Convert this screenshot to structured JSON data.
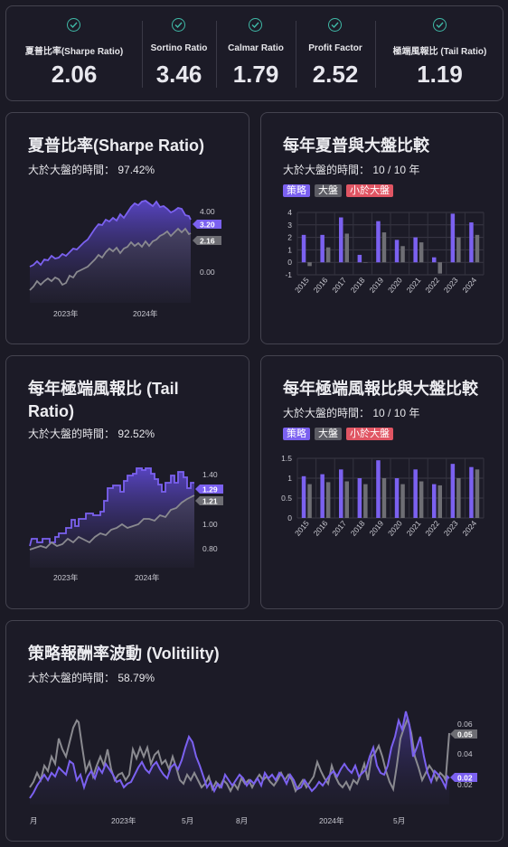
{
  "metrics": [
    {
      "label": "夏普比率(Sharpe Ratio)",
      "value": "2.06"
    },
    {
      "label": "Sortino Ratio",
      "value": "3.46"
    },
    {
      "label": "Calmar Ratio",
      "value": "1.79"
    },
    {
      "label": "Profit Factor",
      "value": "2.52"
    },
    {
      "label": "極端風報比 (Tail Ratio)",
      "value": "1.19"
    }
  ],
  "sharpe_card": {
    "title": "夏普比率(Sharpe Ratio)",
    "subtitle_label": "大於大盤的時間：",
    "subtitle_value": "97.42%",
    "yticks": [
      "4.00",
      "0.00"
    ],
    "strategy_last": "3.20",
    "market_last": "2.16",
    "xticks": [
      "2023年",
      "2024年"
    ]
  },
  "sharpe_yearly_card": {
    "title": "每年夏普與大盤比較",
    "subtitle_label": "大於大盤的時間：",
    "subtitle_value": "10 / 10 年"
  },
  "tail_card": {
    "title_line1": "每年極端風報比 (Tail",
    "title_line2": "Ratio)",
    "subtitle_label": "大於大盤的時間：",
    "subtitle_value": "92.52%",
    "yticks": [
      "1.40",
      "1.00",
      "0.80"
    ],
    "strategy_last": "1.29",
    "market_last": "1.21",
    "xticks": [
      "2023年",
      "2024年"
    ]
  },
  "tail_yearly_card": {
    "title": "每年極端風報比與大盤比較",
    "subtitle_label": "大於大盤的時間：",
    "subtitle_value": "10 / 10 年"
  },
  "vol_card": {
    "title": "策略報酬率波動 (Volitility)",
    "subtitle_label": "大於大盤的時間：",
    "subtitle_value": "58.79%",
    "yticks": [
      "0.06",
      "0.04",
      "0.02"
    ],
    "strategy_last": "0.02",
    "market_last": "0.05",
    "xticks": [
      "月",
      "2023年",
      "5月",
      "8月",
      "2024年",
      "5月"
    ]
  },
  "legend": {
    "strategy": "策略",
    "market": "大盤",
    "below": "小於大盤"
  },
  "colors": {
    "strategy": "#7b61f0",
    "market": "#6e6e74",
    "below": "#e05563",
    "check": "#3fb8a6"
  },
  "chart_data": [
    {
      "type": "bar",
      "title": "每年夏普與大盤比較",
      "categories": [
        "2015",
        "2016",
        "2017",
        "2018",
        "2019",
        "2020",
        "2021",
        "2022",
        "2023",
        "2024"
      ],
      "series": [
        {
          "name": "策略",
          "values": [
            2.2,
            2.2,
            3.6,
            0.6,
            3.3,
            1.8,
            2.0,
            0.4,
            3.9,
            3.2
          ]
        },
        {
          "name": "大盤",
          "values": [
            -0.3,
            1.2,
            2.3,
            0.0,
            2.4,
            1.3,
            1.6,
            -0.9,
            2.0,
            2.2
          ]
        }
      ],
      "yticks": [
        "4",
        "3",
        "2",
        "1",
        "0",
        "-1"
      ],
      "ylim": [
        -1,
        4
      ]
    },
    {
      "type": "bar",
      "title": "每年極端風報比與大盤比較",
      "categories": [
        "2015",
        "2016",
        "2017",
        "2018",
        "2019",
        "2020",
        "2021",
        "2022",
        "2023",
        "2024"
      ],
      "series": [
        {
          "name": "策略",
          "values": [
            1.05,
            1.1,
            1.22,
            1.0,
            1.45,
            1.0,
            1.22,
            0.85,
            1.36,
            1.28
          ]
        },
        {
          "name": "大盤",
          "values": [
            0.85,
            0.9,
            0.92,
            0.85,
            1.0,
            0.85,
            0.92,
            0.82,
            1.0,
            1.22
          ]
        }
      ],
      "yticks": [
        "1.5",
        "1",
        "0.5",
        "0"
      ],
      "ylim": [
        0,
        1.5
      ]
    }
  ]
}
